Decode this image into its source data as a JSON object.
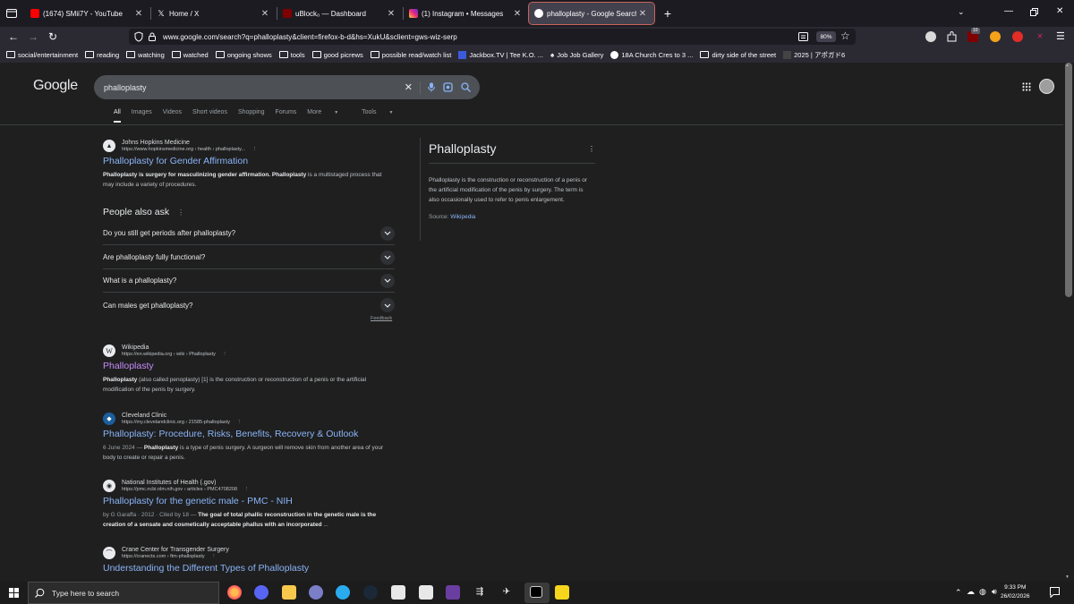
{
  "browser": {
    "tabs": [
      {
        "title": "(1674) SMii7Y - YouTube",
        "color": "#ff0000",
        "active": false
      },
      {
        "title": "Home / X",
        "color": "#ffffff",
        "active": false
      },
      {
        "title": "uBlock₀ — Dashboard",
        "color": "#800000",
        "active": false
      },
      {
        "title": "(1) Instagram • Messages",
        "color": "#d6249f",
        "active": false
      },
      {
        "title": "phalloplasty - Google Search",
        "color": "#4285f4",
        "active": true
      }
    ],
    "url": "www.google.com/search?q=phalloplasty&client=firefox-b-d&hs=XukU&sclient=gws-wiz-serp",
    "zoom": "80%",
    "ext_badge": "10",
    "bookmarks": [
      "social/entertainment",
      "reading",
      "watching",
      "watched",
      "ongoing shows",
      "tools",
      "good picrews",
      "possible read/watch list",
      "Jackbox.TV | Tee K.O. ...",
      "Job Job Gallery",
      "18A Church Cres to 3 ...",
      "dirty side of the street",
      "2025 | アポガド6"
    ]
  },
  "google": {
    "logo": "Google",
    "query": "phalloplasty",
    "nav_tabs": [
      "All",
      "Images",
      "Videos",
      "Short videos",
      "Shopping",
      "Forums",
      "More",
      "Tools"
    ],
    "results": [
      {
        "site": "Johns Hopkins Medicine",
        "url": "https://www.hopkinsmedicine.org › health › phalloplasty...",
        "title": "Phalloplasty for Gender Affirmation",
        "snippet_bold": "Phalloplasty is surgery for masculinizing gender affirmation.",
        "snippet_bold2": "Phalloplasty",
        "snippet_rest": " is a multistaged process that may include a variety of procedures."
      },
      {
        "site": "Wikipedia",
        "url": "https://en.wikipedia.org › wiki › Phalloplasty",
        "title": "Phalloplasty",
        "snippet_bold": "Phalloplasty",
        "snippet_rest": " (also called penoplasty) [1] is the construction or reconstruction of a penis or the artificial modification of the penis by surgery."
      },
      {
        "site": "Cleveland Clinic",
        "url": "https://my.clevelandclinic.org › 21585-phalloplasty",
        "title": "Phalloplasty: Procedure, Risks, Benefits, Recovery & Outlook",
        "date": "6 June 2024 — ",
        "snippet_bold": "Phalloplasty",
        "snippet_rest": " is a type of penis surgery. A surgeon will remove skin from another area of your body to create or repair a penis."
      },
      {
        "site": "National Institutes of Health (.gov)",
        "url": "https://pmc.ncbi.nlm.nih.gov › articles › PMC4708208",
        "title": "Phalloplasty for the genetic male - PMC - NIH",
        "date": "by G Garaffa · 2012 · Cited by 18 — ",
        "snippet_bold": "The goal of total phallic reconstruction in the genetic male is the creation of a sensate and cosmetically acceptable phallus with an incorporated",
        "snippet_rest": " ..."
      },
      {
        "site": "Crane Center for Transgender Surgery",
        "url": "https://cranects.com › ftm-phalloplasty",
        "title": "Understanding the Different Types of Phalloplasty"
      }
    ],
    "people_also_ask": {
      "heading": "People also ask",
      "questions": [
        "Do you still get periods after phalloplasty?",
        "Are phalloplasty fully functional?",
        "What is a phalloplasty?",
        "Can males get phalloplasty?"
      ],
      "feedback": "Feedback"
    },
    "knowledge_panel": {
      "title": "Phalloplasty",
      "description": "Phalloplasty is the construction or reconstruction of a penis or the artificial modification of the penis by surgery. The term is also occasionally used to refer to penis enlargement.",
      "source_label": "Source: ",
      "source_link": "Wikipedia"
    }
  },
  "taskbar": {
    "search_placeholder": "Type here to search",
    "time": "9:33 PM",
    "date": "26/02/2026"
  }
}
